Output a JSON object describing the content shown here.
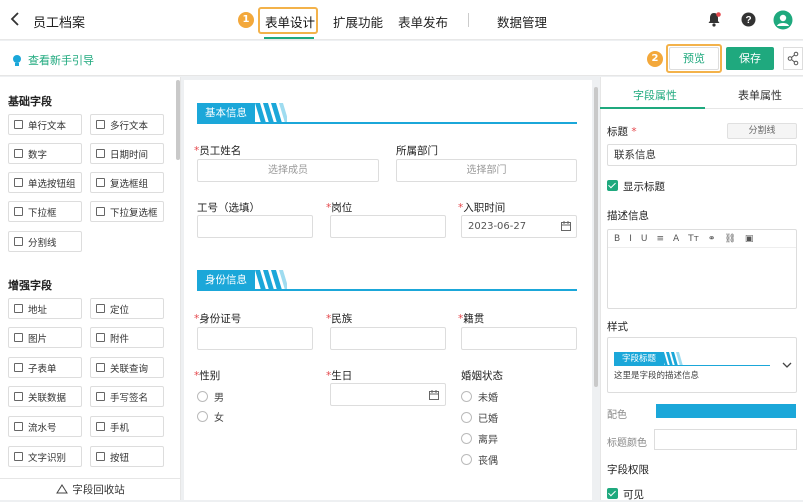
{
  "header": {
    "title": "员工档案",
    "tabs": [
      "表单设计",
      "扩展功能",
      "表单发布",
      "数据管理"
    ],
    "step1": "1",
    "step2": "2"
  },
  "subbar": {
    "guide": "查看新手引导",
    "preview": "预览",
    "save": "保存"
  },
  "left": {
    "basic_title": "基础字段",
    "basic": [
      "单行文本",
      "多行文本",
      "数字",
      "日期时间",
      "单选按钮组",
      "复选框组",
      "下拉框",
      "下拉复选框",
      "分割线"
    ],
    "advanced_title": "增强字段",
    "advanced": [
      "地址",
      "定位",
      "图片",
      "附件",
      "子表单",
      "关联查询",
      "关联数据",
      "手写签名",
      "流水号",
      "手机",
      "文字识别",
      "按钮"
    ],
    "recycle": "字段回收站"
  },
  "canvas": {
    "sec1": "基本信息",
    "sec2": "身份信息",
    "name_label": "员工姓名",
    "name_ph": "选择成员",
    "dept_label": "所属部门",
    "dept_ph": "选择部门",
    "jobno_label": "工号（选填）",
    "post_label": "岗位",
    "join_label": "入职时间",
    "join_value": "2023-06-27",
    "id_label": "身份证号",
    "nation_label": "民族",
    "native_label": "籍贯",
    "gender_label": "性别",
    "gender": [
      "男",
      "女"
    ],
    "birth_label": "生日",
    "marital_label": "婚姻状态",
    "marital": [
      "未婚",
      "已婚",
      "离异",
      "丧偶"
    ]
  },
  "right": {
    "tab_field": "字段属性",
    "tab_form": "表单属性",
    "title_label": "标题",
    "divider_btn": "分割线",
    "title_value": "联系信息",
    "show_title": "显示标题",
    "desc_label": "描述信息",
    "toolbar": [
      "B",
      "I",
      "U",
      "≡",
      "A",
      "Tт",
      "⚭",
      "⛓",
      "▣"
    ],
    "style_label": "样式",
    "style_preview_title": "字段标题",
    "style_preview_desc": "这里是字段的描述信息",
    "color_label": "配色",
    "title_color_label": "标题颜色",
    "perm_label": "字段权限",
    "visible": "可见"
  },
  "colors": {
    "accent": "#1fa97e",
    "section": "#1ba7d9",
    "highlight": "#f3b24a"
  }
}
